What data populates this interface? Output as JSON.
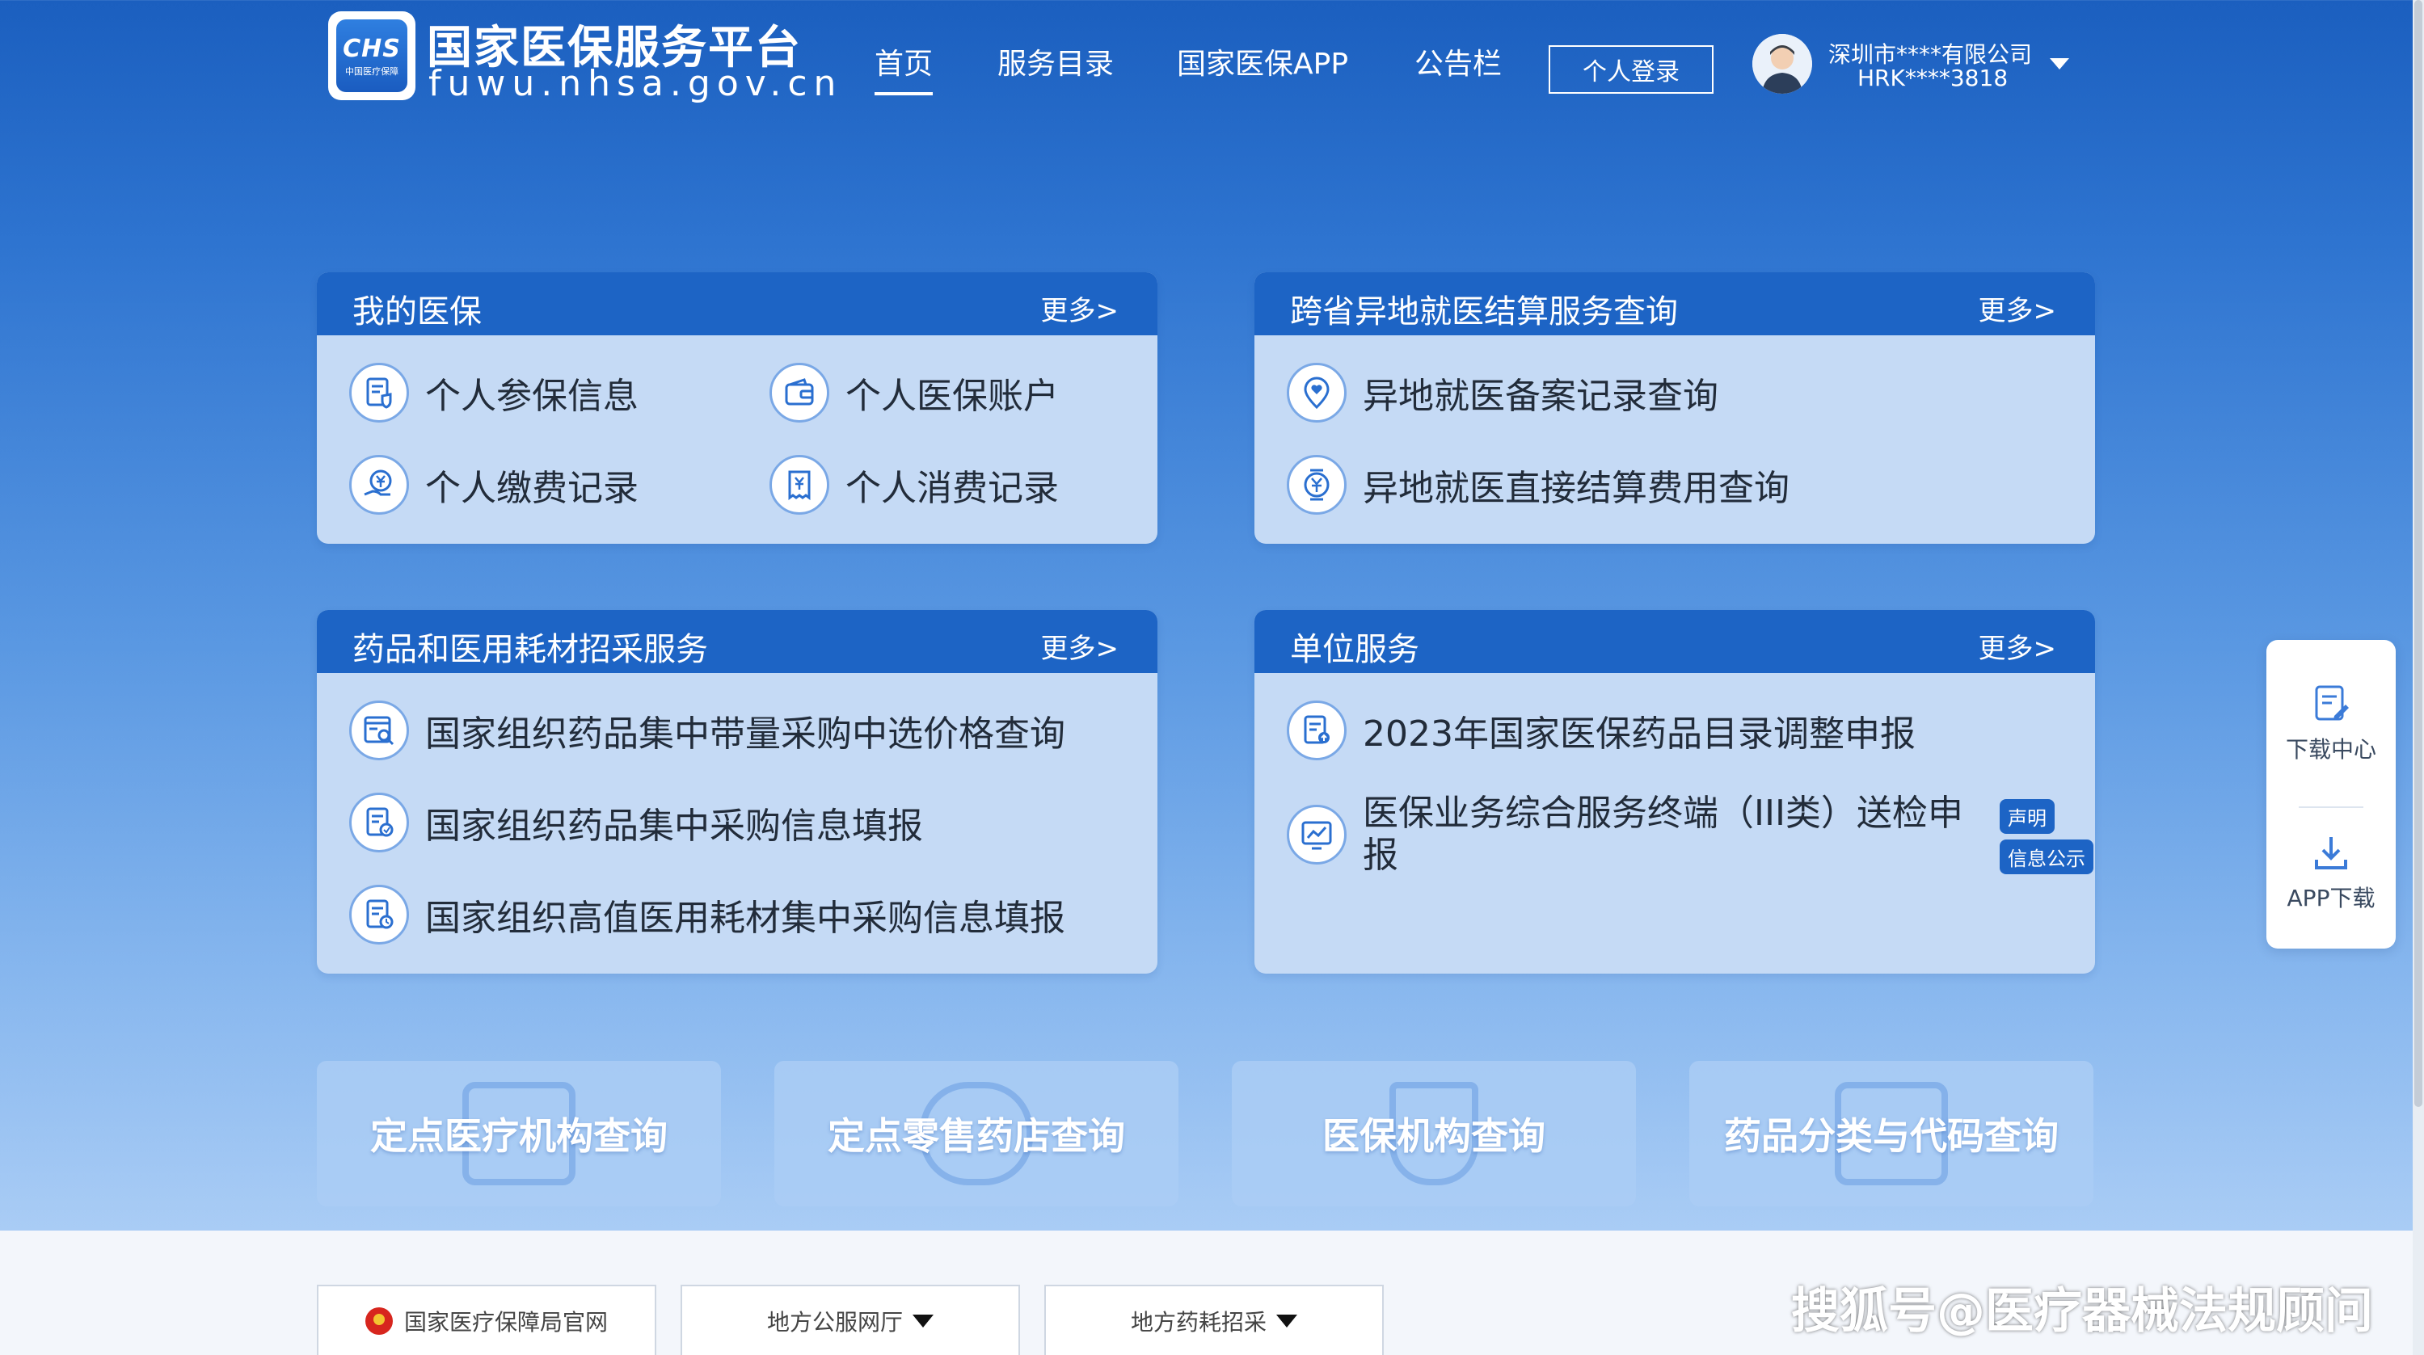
{
  "brand": {
    "logo_mark": "CHS",
    "logo_sub": "中国医疗保障",
    "title": "国家医保服务平台",
    "url": "fuwu.nhsa.gov.cn"
  },
  "nav": {
    "items": [
      "首页",
      "服务目录",
      "国家医保APP",
      "公告栏"
    ],
    "active": "首页",
    "login_label": "个人登录"
  },
  "user": {
    "name": "深圳市****有限公司",
    "id": "HRK****3818"
  },
  "panels": {
    "my_insurance": {
      "title": "我的医保",
      "more": "更多>",
      "items": [
        "个人参保信息",
        "个人医保账户",
        "个人缴费记录",
        "个人消费记录"
      ]
    },
    "cross_province": {
      "title": "跨省异地就医结算服务查询",
      "more": "更多>",
      "items": [
        "异地就医备案记录查询",
        "异地就医直接结算费用查询"
      ]
    },
    "procurement": {
      "title": "药品和医用耗材招采服务",
      "more": "更多>",
      "items": [
        "国家组织药品集中带量采购中选价格查询",
        "国家组织药品集中采购信息填报",
        "国家组织高值医用耗材集中采购信息填报"
      ]
    },
    "unit_service": {
      "title": "单位服务",
      "more": "更多>",
      "items": [
        "2023年国家医保药品目录调整申报",
        "医保业务综合服务终端（III类）送检申报"
      ],
      "tags": [
        "声明",
        "信息公示"
      ]
    }
  },
  "quick_links": [
    "定点医疗机构查询",
    "定点零售药店查询",
    "医保机构查询",
    "药品分类与代码查询"
  ],
  "side_widget": {
    "download_center": "下载中心",
    "app_download": "APP下载"
  },
  "footer": {
    "links": [
      "国家医疗保障局官网",
      "地方公服网厅",
      "地方药耗招采"
    ]
  },
  "watermark": "搜狐号@医疗器械法规顾问"
}
